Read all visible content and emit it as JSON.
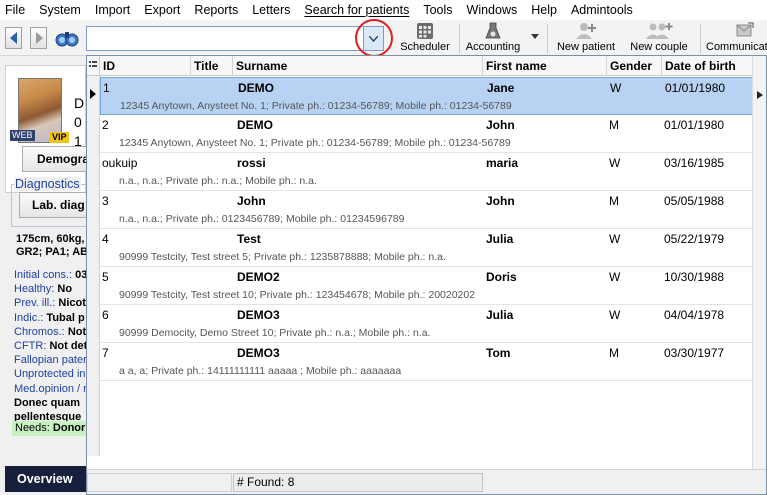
{
  "menu": [
    "File",
    "System",
    "Import",
    "Export",
    "Reports",
    "Letters",
    "Search for patients",
    "Tools",
    "Windows",
    "Help",
    "Admintools"
  ],
  "search": {
    "value": "",
    "placeholder": ""
  },
  "toolbar": {
    "scheduler": "Scheduler",
    "accounting": "Accounting",
    "new_patient": "New patient",
    "new_couple": "New couple",
    "communication": "Communicati"
  },
  "patient_card": {
    "badge_web": "WEB",
    "badge_vip": "VIP",
    "letters": [
      "D",
      "0",
      "1"
    ]
  },
  "left": {
    "demographics_button": "Demogra",
    "diagnostics_label": "Diagnostics",
    "lab_button": "Lab. diag",
    "vitals_line1": "175cm, 60kg,",
    "vitals_line2": "GR2; PA1; AB",
    "info": [
      {
        "label": "Initial cons.:",
        "value": "03"
      },
      {
        "label": "Healthy:",
        "value": "No"
      },
      {
        "label": "Prev. ill.:",
        "value": "Nicot"
      },
      {
        "label": "Indic.:",
        "value": "Tubal p"
      },
      {
        "label": "Chromos.:",
        "value": "Not"
      },
      {
        "label": "CFTR:",
        "value": "Not det"
      },
      {
        "label": "Fallopian pater",
        "value": ""
      },
      {
        "label": "Unprotected in",
        "value": ""
      },
      {
        "label": "Med.opinion / r",
        "value": ""
      }
    ],
    "note_line1": "Donec quam",
    "note_line2": "pellentesque",
    "needs_label": "Needs:",
    "needs_value": "Donor",
    "overview_tab": "Overview"
  },
  "grid": {
    "columns": [
      "ID",
      "Title",
      "Surname",
      "First name",
      "Gender",
      "Date of birth"
    ],
    "rows": [
      {
        "id": "1",
        "title": "",
        "surname": "DEMO",
        "first": "Jane",
        "gender": "W",
        "dob": "01/01/1980",
        "address": "12345 Anytown, Anysteet No. 1; Private ph.: 01234-56789; Mobile ph.: 01234-56789"
      },
      {
        "id": "2",
        "title": "",
        "surname": "DEMO",
        "first": "John",
        "gender": "M",
        "dob": "01/01/1980",
        "address": "12345 Anytown, Anysteet No. 1; Private ph.: 01234-56789; Mobile ph.: 01234-56789"
      },
      {
        "id": "oukuip",
        "title": "",
        "surname": "rossi",
        "first": "maria",
        "gender": "W",
        "dob": "03/16/1985",
        "address": "n.a., n.a.; Private ph.: n.a.; Mobile ph.: n.a."
      },
      {
        "id": "3",
        "title": "",
        "surname": "John",
        "first": "John",
        "gender": "M",
        "dob": "05/05/1988",
        "address": "n.a., n.a.; Private ph.: 0123456789; Mobile ph.: 01234596789"
      },
      {
        "id": "4",
        "title": "",
        "surname": "Test",
        "first": "Julia",
        "gender": "W",
        "dob": "05/22/1979",
        "address": "90999 Testcity, Test street 5; Private ph.: 1235878888; Mobile ph.: n.a."
      },
      {
        "id": "5",
        "title": "",
        "surname": "DEMO2",
        "first": "Doris",
        "gender": "W",
        "dob": "10/30/1988",
        "address": "90999 Testcity, Test street 10; Private ph.: 123454678; Mobile ph.: 20020202"
      },
      {
        "id": "6",
        "title": "",
        "surname": "DEMO3",
        "first": "Julia",
        "gender": "W",
        "dob": "04/04/1978",
        "address": "90999 Democity, Demo Street 10; Private ph.: n.a.; Mobile ph.: n.a."
      },
      {
        "id": "7",
        "title": "",
        "surname": "DEMO3",
        "first": "Tom",
        "gender": "M",
        "dob": "03/30/1977",
        "address": "a a, a; Private ph.: 14111111111 aaaaa ; Mobile ph.: aaaaaaa"
      }
    ],
    "found_text": "# Found: 8"
  }
}
